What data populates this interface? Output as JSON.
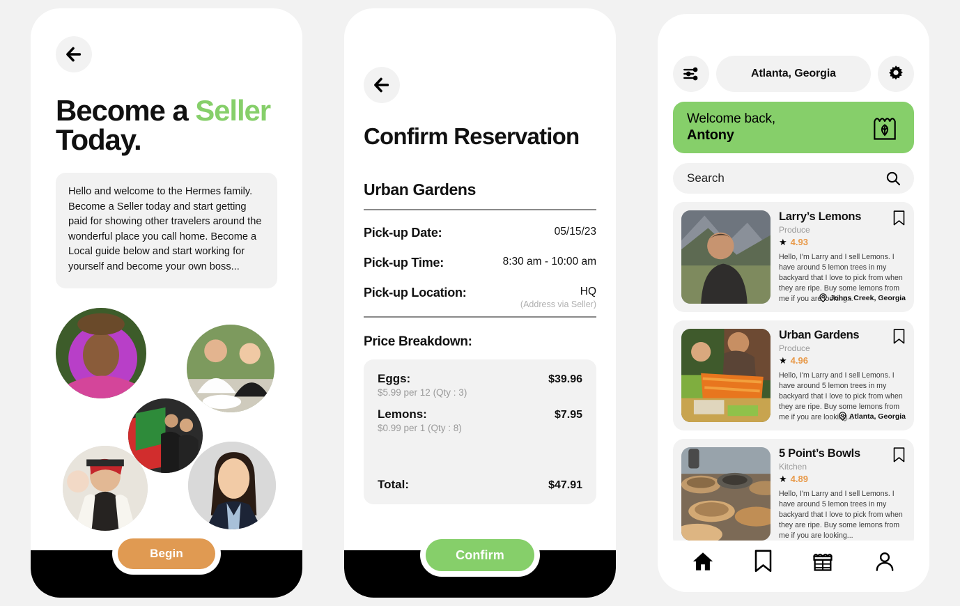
{
  "colors": {
    "green_accent": "#86cf6a",
    "orange_button": "#e09a52",
    "rating_orange": "#e89a4a",
    "surface_gray": "#f2f2f2",
    "page_background": "#f2f2f2",
    "text_primary": "#111111",
    "muted_text": "#9a9a9a"
  },
  "screen_onboarding": {
    "back_icon": "arrow-left-icon",
    "title_line1_before": "Become a ",
    "title_accent": "Seller",
    "title_line2": "Today.",
    "blurb": "Hello and welcome to the Hermes family. Become a Seller today and start getting paid for showing other travelers around the wonderful place you call home. Become a Local guide below and start working for yourself and become your own boss...",
    "avatars": [
      {
        "name": "avatar-woman-purple-veil"
      },
      {
        "name": "avatar-couple-dining"
      },
      {
        "name": "avatar-friends-flag"
      },
      {
        "name": "avatar-man-festival"
      },
      {
        "name": "avatar-woman-suit"
      }
    ],
    "begin_button": "Begin"
  },
  "screen_confirm": {
    "back_icon": "arrow-left-icon",
    "title": "Confirm Reservation",
    "seller_name": "Urban Gardens",
    "details": [
      {
        "label": "Pick-up Date:",
        "value": "05/15/23",
        "note": ""
      },
      {
        "label": "Pick-up Time:",
        "value": "8:30 am - 10:00 am",
        "note": ""
      },
      {
        "label": "Pick-up Location:",
        "value": "HQ",
        "note": "(Address via Seller)"
      }
    ],
    "price_breakdown_title": "Price Breakdown:",
    "line_items": [
      {
        "name": "Eggs:",
        "meta": "$5.99 per 12 (Qty : 3)",
        "amount": "$39.96"
      },
      {
        "name": "Lemons:",
        "meta": "$0.99 per 1 (Qty : 8)",
        "amount": "$7.95"
      }
    ],
    "total_label": "Total:",
    "total_amount": "$47.91",
    "confirm_button": "Confirm"
  },
  "screen_home": {
    "filter_icon": "sliders-icon",
    "location": "Atlanta, Georgia",
    "settings_icon": "gear-icon",
    "welcome_line1": "Welcome back,",
    "welcome_name": "Antony",
    "storefront_icon": "storefront-leaf-icon",
    "search_placeholder": "Search",
    "search_icon": "search-icon",
    "listings": [
      {
        "title": "Larry’s Lemons",
        "category": "Produce",
        "rating": "4.93",
        "description": "Hello, I'm Larry and I sell Lemons. I have around 5 lemon trees in my backyard that I love to pick from when they are ripe. Buy some lemons from me if you are looking...",
        "location": "Johns Creek, Georgia",
        "thumb": "photo-man-mountains",
        "bookmark_icon": "bookmark-icon"
      },
      {
        "title": "Urban Gardens",
        "category": "Produce",
        "rating": "4.96",
        "description": "Hello, I'm Larry and I sell Lemons. I have around 5 lemon trees in my backyard that I love to pick from when they are ripe. Buy some lemons from me if you are looking...",
        "location": "Atlanta, Georgia",
        "thumb": "photo-farmers-market-carrots",
        "bookmark_icon": "bookmark-icon"
      },
      {
        "title": "5 Point’s Bowls",
        "category": "Kitchen",
        "rating": "4.89",
        "description": "Hello, I'm Larry and I sell Lemons. I have around 5 lemon trees in my backyard that I love to pick from when they are ripe. Buy some lemons from me if you are looking...",
        "location": "",
        "thumb": "photo-wooden-bowls",
        "bookmark_icon": "bookmark-icon"
      }
    ],
    "tabs": [
      {
        "icon": "home-icon",
        "active": true
      },
      {
        "icon": "bookmark-icon",
        "active": false
      },
      {
        "icon": "storefront-icon",
        "active": false
      },
      {
        "icon": "person-icon",
        "active": false
      }
    ]
  }
}
